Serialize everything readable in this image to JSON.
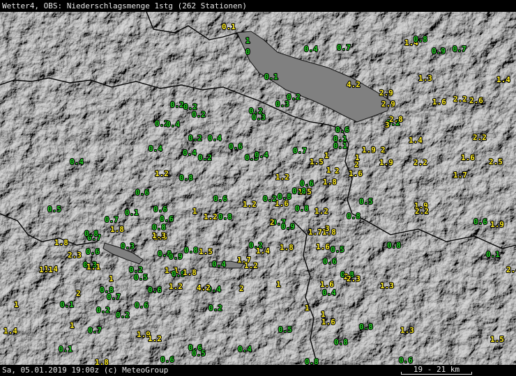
{
  "window": {
    "title": "Wetter4, OBS: Niederschlagsmenge 1stg (262 Stationen)",
    "footer_text": "Sa, 05.01.2019 19:00z (c) MeteoGroup",
    "scale_label": "19 - 21 km"
  },
  "colors": {
    "low": "#22cc22",
    "high": "#ffee22",
    "lake": "#808080",
    "border": "#000000"
  },
  "stations": [
    {
      "v": "0.1",
      "x": 1
    },
    {
      "v": "1",
      "x": 0
    },
    {
      "v": "0",
      "x": 0
    },
    {
      "v": "0.4",
      "x": 0
    },
    {
      "v": "0.7",
      "x": 0
    },
    {
      "v": "1.4",
      "x": 1
    },
    {
      "v": "0.8",
      "x": 0
    },
    {
      "v": "0.9",
      "x": 0
    },
    {
      "v": "0.7",
      "x": 0
    },
    {
      "v": "0.1",
      "x": 0
    },
    {
      "v": "1.3",
      "x": 1
    },
    {
      "v": "1.4",
      "x": 1
    },
    {
      "v": "4.2",
      "x": 1
    },
    {
      "v": "0.2",
      "x": 0
    },
    {
      "v": "2.9",
      "x": 1
    },
    {
      "v": "2.9",
      "x": 1
    },
    {
      "v": "0.3",
      "x": 0
    },
    {
      "v": "0.2",
      "x": 0
    },
    {
      "v": "0.2",
      "x": 0
    },
    {
      "v": "0.2",
      "x": 0
    },
    {
      "v": "0.2",
      "x": 0
    },
    {
      "v": "0.3",
      "x": 0
    },
    {
      "v": "1.6",
      "x": 1
    },
    {
      "v": "2.2",
      "x": 1
    },
    {
      "v": "2.6",
      "x": 1
    },
    {
      "v": "0.2",
      "x": 0
    },
    {
      "v": "0.4",
      "x": 0
    },
    {
      "v": "0.2",
      "x": 0
    },
    {
      "v": "2.8",
      "x": 1
    },
    {
      "v": "3",
      "x": 1
    },
    {
      "v": "0.6",
      "x": 0
    },
    {
      "v": "0.2",
      "x": 0
    },
    {
      "v": "0.4",
      "x": 0
    },
    {
      "v": "0.1",
      "x": 0
    },
    {
      "v": "1.4",
      "x": 1
    },
    {
      "v": "2.2",
      "x": 1
    },
    {
      "v": "0.4",
      "x": 0
    },
    {
      "v": "0.4",
      "x": 0
    },
    {
      "v": "0.2",
      "x": 0
    },
    {
      "v": "0.6",
      "x": 0
    },
    {
      "v": "0.5",
      "x": 0
    },
    {
      "v": "0.4",
      "x": 0
    },
    {
      "v": "0.7",
      "x": 0
    },
    {
      "v": "0.1",
      "x": 0
    },
    {
      "v": "1.9",
      "x": 1
    },
    {
      "v": "2",
      "x": 1
    },
    {
      "v": "1",
      "x": 1
    },
    {
      "v": "0.4",
      "x": 0
    },
    {
      "v": "1.5",
      "x": 1
    },
    {
      "v": "1",
      "x": 1
    },
    {
      "v": "2",
      "x": 1
    },
    {
      "v": "1.9",
      "x": 1
    },
    {
      "v": "2.2",
      "x": 1
    },
    {
      "v": "1.6",
      "x": 1
    },
    {
      "v": "2.5",
      "x": 1
    },
    {
      "v": "1.2",
      "x": 1
    },
    {
      "v": "0.8",
      "x": 0
    },
    {
      "v": "1.2",
      "x": 1
    },
    {
      "v": "1",
      "x": 1
    },
    {
      "v": "2",
      "x": 1
    },
    {
      "v": "1.6",
      "x": 1
    },
    {
      "v": "1.7",
      "x": 1
    },
    {
      "v": "0.6",
      "x": 0
    },
    {
      "v": "0.6",
      "x": 0
    },
    {
      "v": "0.8",
      "x": 0
    },
    {
      "v": "0.6",
      "x": 0
    },
    {
      "v": "1.8",
      "x": 1
    },
    {
      "v": "1.6",
      "x": 1
    },
    {
      "v": "0.2",
      "x": 0
    },
    {
      "v": "1.5",
      "x": 1
    },
    {
      "v": "0.8",
      "x": 0
    },
    {
      "v": "0.5",
      "x": 0
    },
    {
      "v": "0.1",
      "x": 0
    },
    {
      "v": "0.6",
      "x": 0
    },
    {
      "v": "1",
      "x": 1
    },
    {
      "v": "1.2",
      "x": 1
    },
    {
      "v": "0.8",
      "x": 0
    },
    {
      "v": "1.2",
      "x": 1
    },
    {
      "v": "0.8",
      "x": 0
    },
    {
      "v": "1.2",
      "x": 1
    },
    {
      "v": "0.5",
      "x": 0
    },
    {
      "v": "1.9",
      "x": 1
    },
    {
      "v": "2.2",
      "x": 1
    },
    {
      "v": "0.7",
      "x": 0
    },
    {
      "v": "0.6",
      "x": 0
    },
    {
      "v": "1.8",
      "x": 1
    },
    {
      "v": "0.8",
      "x": 0
    },
    {
      "v": "0.7",
      "x": 0
    },
    {
      "v": "0.8",
      "x": 0
    },
    {
      "v": "2",
      "x": 1
    },
    {
      "v": "0.9",
      "x": 0
    },
    {
      "v": "1.5",
      "x": 1
    },
    {
      "v": "1.7",
      "x": 1
    },
    {
      "v": "1.8",
      "x": 1
    },
    {
      "v": "3",
      "x": 1
    },
    {
      "v": "0.6",
      "x": 0
    },
    {
      "v": "1.9",
      "x": 1
    },
    {
      "v": "0.7",
      "x": 0
    },
    {
      "v": "0.8",
      "x": 0
    },
    {
      "v": "1.3",
      "x": 1
    },
    {
      "v": "1.8",
      "x": 1
    },
    {
      "v": "0.3",
      "x": 0
    },
    {
      "v": "0.2",
      "x": 0
    },
    {
      "v": "1.4",
      "x": 1
    },
    {
      "v": "1.8",
      "x": 1
    },
    {
      "v": "1.6",
      "x": 1
    },
    {
      "v": "0.5",
      "x": 0
    },
    {
      "v": "0.8",
      "x": 0
    },
    {
      "v": "2.3",
      "x": 1
    },
    {
      "v": "0.6",
      "x": 0
    },
    {
      "v": "0.8",
      "x": 0
    },
    {
      "v": "0.9",
      "x": 0
    },
    {
      "v": "0.8",
      "x": 0
    },
    {
      "v": "1.5",
      "x": 1
    },
    {
      "v": "1.4",
      "x": 1
    },
    {
      "v": "0.3",
      "x": 0
    },
    {
      "v": "0.1",
      "x": 0
    },
    {
      "v": "1.1",
      "x": 1
    },
    {
      "v": "0.4",
      "x": 0
    },
    {
      "v": "1.7",
      "x": 1
    },
    {
      "v": "1.2",
      "x": 1
    },
    {
      "v": "0.6",
      "x": 0
    },
    {
      "v": "1.1",
      "x": 1
    },
    {
      "v": "0.2",
      "x": 0
    },
    {
      "v": "1.1",
      "x": 1
    },
    {
      "v": "0.9",
      "x": 0
    },
    {
      "v": "0.5",
      "x": 0
    },
    {
      "v": "1.8",
      "x": 1
    },
    {
      "v": "0.8",
      "x": 0
    },
    {
      "v": "2",
      "x": 1
    },
    {
      "v": "2.3",
      "x": 1
    },
    {
      "v": "2.4",
      "x": 1
    },
    {
      "v": "1",
      "x": 1
    },
    {
      "v": "1.2",
      "x": 1
    },
    {
      "v": "1",
      "x": 1
    },
    {
      "v": "1.6",
      "x": 1
    },
    {
      "v": "1.3",
      "x": 1
    },
    {
      "v": "2",
      "x": 1
    },
    {
      "v": "0.8",
      "x": 0
    },
    {
      "v": "0.7",
      "x": 0
    },
    {
      "v": "0.2",
      "x": 0
    },
    {
      "v": "0.4",
      "x": 0
    },
    {
      "v": "4.2",
      "x": 1
    },
    {
      "v": "1",
      "x": 1
    },
    {
      "v": "0.1",
      "x": 0
    },
    {
      "v": "0.2",
      "x": 0
    },
    {
      "v": "0.6",
      "x": 0
    },
    {
      "v": "0.6",
      "x": 0
    },
    {
      "v": "1",
      "x": 1
    },
    {
      "v": "2",
      "x": 1
    },
    {
      "v": "0.4",
      "x": 0
    },
    {
      "v": "1",
      "x": 1
    },
    {
      "v": "1",
      "x": 1
    },
    {
      "v": "0.7",
      "x": 0
    },
    {
      "v": "0.2",
      "x": 0
    },
    {
      "v": "1.6",
      "x": 1
    },
    {
      "v": "1.4",
      "x": 1
    },
    {
      "v": "0.5",
      "x": 0
    },
    {
      "v": "0.8",
      "x": 0
    },
    {
      "v": "1.3",
      "x": 1
    },
    {
      "v": "1.9",
      "x": 1
    },
    {
      "v": "1.2",
      "x": 1
    },
    {
      "v": "1.5",
      "x": 1
    },
    {
      "v": "0.1",
      "x": 0
    },
    {
      "v": "0.6",
      "x": 0
    },
    {
      "v": "0.5",
      "x": 0
    },
    {
      "v": "0.4",
      "x": 0
    },
    {
      "v": "0.8",
      "x": 0
    },
    {
      "v": "1.8",
      "x": 1
    },
    {
      "v": "0.6",
      "x": 0
    },
    {
      "v": "0.8",
      "x": 0
    },
    {
      "v": "0.6",
      "x": 0
    },
    {
      "v": "1",
      "x": 1
    }
  ]
}
